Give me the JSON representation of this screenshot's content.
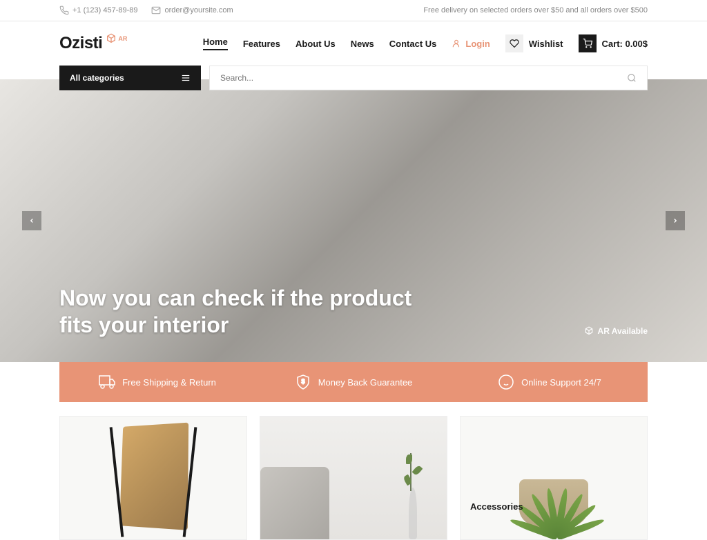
{
  "topbar": {
    "phone": "+1 (123) 457-89-89",
    "email": "order@yoursite.com",
    "delivery_note": "Free delivery on selected orders over $50 and all orders over $500"
  },
  "logo": {
    "text": "Ozisti",
    "badge": "AR"
  },
  "nav": {
    "items": [
      "Home",
      "Features",
      "About Us",
      "News",
      "Contact Us"
    ],
    "active_index": 0,
    "login": "Login",
    "wishlist": "Wishlist",
    "cart": "Cart: 0.00$"
  },
  "categories": {
    "label": "All categories"
  },
  "search": {
    "placeholder": "Search..."
  },
  "hero": {
    "title_line1": "Now you can check if the product",
    "title_line2": "fits your interior",
    "ar_label": "AR Available"
  },
  "features": [
    {
      "label": "Free Shipping & Return"
    },
    {
      "label": "Money Back Guarantee"
    },
    {
      "label": "Online Support 24/7"
    }
  ],
  "products": [
    {
      "label": ""
    },
    {
      "label": ""
    },
    {
      "label": "Accessories"
    }
  ]
}
